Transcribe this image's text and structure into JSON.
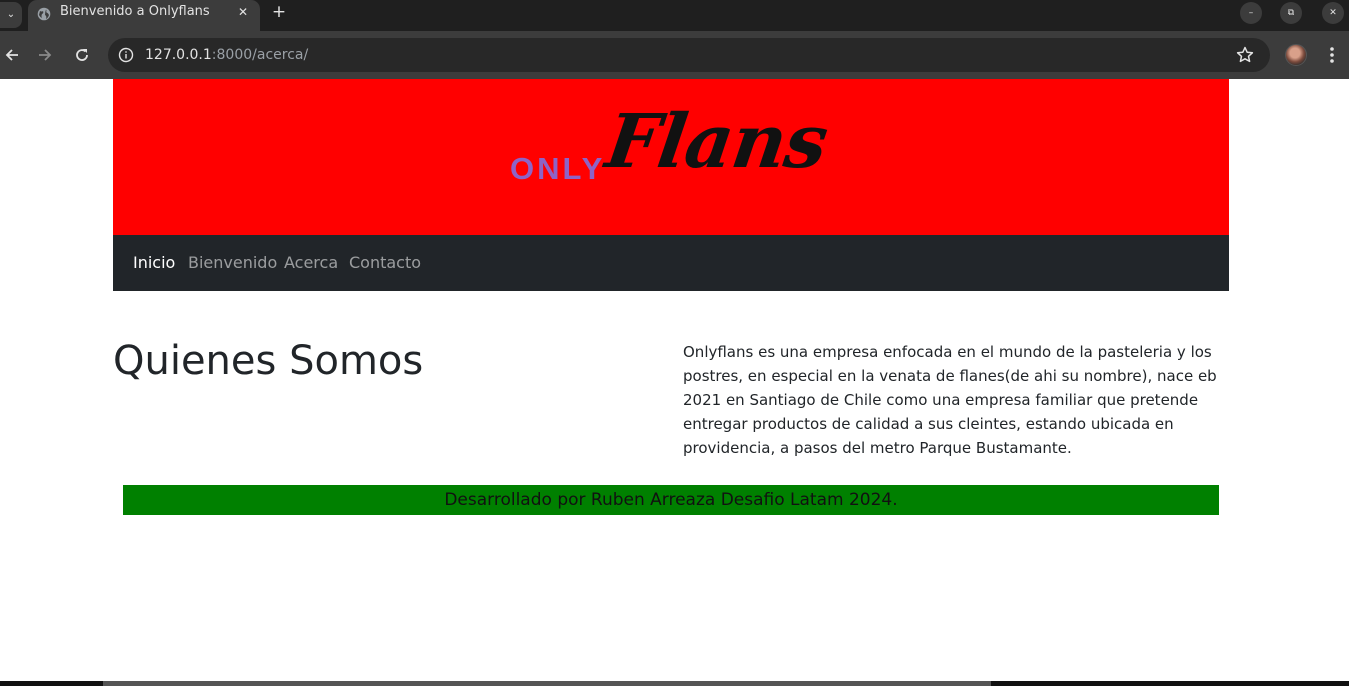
{
  "browser": {
    "tab": {
      "title": "Bienvenido a Onlyflans",
      "close_glyph": "✕"
    },
    "tab_search_glyph": "⌄",
    "new_tab_glyph": "+",
    "window_controls": {
      "minimize_glyph": "–",
      "maximize_glyph": "⧉",
      "close_glyph": "✕"
    },
    "address": {
      "host": "127.0.0.1",
      "rest": ":8000/acerca/"
    },
    "icons": [
      "back-icon",
      "forward-icon",
      "reload-icon",
      "info-icon",
      "bookmark-star-icon",
      "profile-avatar",
      "menu-icon"
    ]
  },
  "site": {
    "logo": {
      "only": "ONLY",
      "flans": "Flans"
    },
    "nav": {
      "inicio": "Inicio",
      "bienvenido": "Bienvenido",
      "acerca": "Acerca",
      "contacto": "Contacto"
    },
    "about": {
      "title": "Quienes Somos",
      "text": "Onlyflans es una empresa enfocada en el mundo de la pasteleria y los postres, en especial en la venata de flanes(de ahi su nombre), nace eb 2021 en Santiago de Chile como una empresa familiar que pretende entregar productos de calidad a sus cleintes, estando ubicada en providencia, a pasos del metro Parque Bustamante."
    },
    "footer": {
      "text": "Desarrollado por Ruben Arreaza Desafio Latam 2024."
    },
    "colors": {
      "hero": "#ff0000",
      "navbar": "#212529",
      "footer": "#008000",
      "logo_only": "#8e63c6"
    }
  }
}
